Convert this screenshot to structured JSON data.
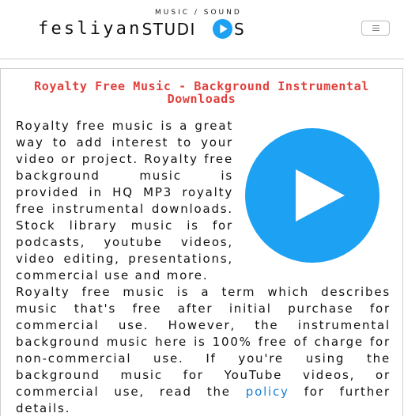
{
  "header": {
    "logo_tagline": "MUSIC / SOUND",
    "logo_wordmark_left": "fesliyan",
    "logo_wordmark_studi": "STUDI",
    "logo_wordmark_s": "S",
    "menu_toggle_icon": "hamburger-icon"
  },
  "main": {
    "title": "Royalty Free Music - Background Instrumental Downloads",
    "intro": "Royalty free music is a great way to add interest to your video or project. Royalty free background music is provided in HQ MP3 royalty free instrumental downloads. Stock library music is for podcasts, youtube videos, video editing, presentations, commercial use and more.",
    "body_before_link": "Royalty free music is a term which describes music that's free after initial purchase for commercial use. However, the instrumental background music here is 100% free of charge for non-commercial use. If you're using the background music for YouTube videos, or commercial use, read the ",
    "policy_link": "policy",
    "body_after_link": " for further details.",
    "play_icon": "play-icon"
  },
  "colors": {
    "title_red": "#e0403c",
    "play_blue": "#1da1f2",
    "link_blue": "#1a7fd4"
  }
}
